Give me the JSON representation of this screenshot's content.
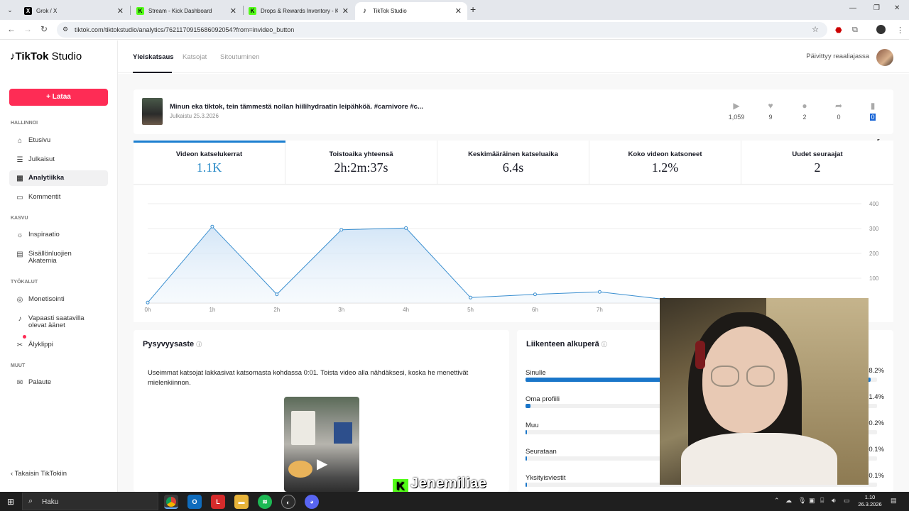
{
  "browser": {
    "tabs": [
      {
        "title": "Grok / X",
        "favicon": "X"
      },
      {
        "title": "Stream - Kick Dashboard",
        "favicon": "K"
      },
      {
        "title": "Drops & Rewards Inventory - K",
        "favicon": "K"
      },
      {
        "title": "TikTok Studio",
        "favicon": "♪"
      }
    ],
    "url": "tiktok.com/tiktokstudio/analytics/7621170915686092054?from=invideo_button"
  },
  "sidebar": {
    "logo_brand": "TikTok",
    "logo_suffix": "Studio",
    "upload_label": "Lataa",
    "sections": {
      "manage": "HALLINNOI",
      "grow": "KASVU",
      "tools": "TYÖKALUT",
      "other": "MUUT"
    },
    "items": {
      "home": "Etusivu",
      "posts": "Julkaisut",
      "analytics": "Analytiikka",
      "comments": "Kommentit",
      "inspiration": "Inspiraatio",
      "academy": "Sisällönluojien Akatemia",
      "monetization": "Monetisointi",
      "sounds": "Vapaasti saatavilla olevat äänet",
      "smartclip": "Älyklippi",
      "feedback": "Palaute"
    },
    "back_link": "Takaisin TikTokiin"
  },
  "header": {
    "tabs": [
      "Yleiskatsaus",
      "Katsojat",
      "Sitoutuminen"
    ],
    "realtime": "Päivittyy reaaliajassa"
  },
  "video": {
    "title": "Minun eka tiktok, tein tämmestä nollan hiilihydraatin leipähköä. #carnivore #c...",
    "published": "Julkaistu 25.3.2026",
    "stats": {
      "views": "1,059",
      "likes": "9",
      "comments": "2",
      "shares": "0",
      "saves": "0"
    }
  },
  "metrics": [
    {
      "label": "Videon katselukerrat",
      "value": "1.1K"
    },
    {
      "label": "Toistoaika yhteensä",
      "value": "2h:2m:37s"
    },
    {
      "label": "Keskimääräinen katseluaika",
      "value": "6.4s"
    },
    {
      "label": "Koko videon katsoneet",
      "value": "1.2%"
    },
    {
      "label": "Uudet seuraajat",
      "value": "2"
    }
  ],
  "chart_data": {
    "type": "area",
    "x": [
      "0h",
      "1h",
      "2h",
      "3h",
      "4h",
      "5h",
      "6h",
      "7h",
      "8h"
    ],
    "values": [
      2,
      308,
      35,
      295,
      302,
      22,
      35,
      45,
      15
    ],
    "yticks": [
      100,
      200,
      300,
      400
    ],
    "ylim": [
      0,
      400
    ],
    "grid": true,
    "color": "#3a8fd0"
  },
  "retention": {
    "title": "Pysyvyysaste",
    "text": "Useimmat katsojat lakkasivat katsomasta kohdassa 0:01. Toista video alla nähdäksesi, koska he menettivät mielenkiinnon."
  },
  "traffic": {
    "title": "Liikenteen alkuperä",
    "rows": [
      {
        "label": "Sinulle",
        "pct": "8.2%",
        "value": 0.982
      },
      {
        "label": "Oma profiili",
        "pct": "1.4%",
        "value": 0.014
      },
      {
        "label": "Muu",
        "pct": "0.2%",
        "value": 0.002
      },
      {
        "label": "Seurataan",
        "pct": "0.1%",
        "value": 0.001
      },
      {
        "label": "Yksityisviestit",
        "pct": "0.1%",
        "value": 0.001
      }
    ]
  },
  "overlay_name": "Jenemiliae",
  "taskbar": {
    "search": "Haku",
    "time": "1.10",
    "date": "26.3.2026"
  }
}
